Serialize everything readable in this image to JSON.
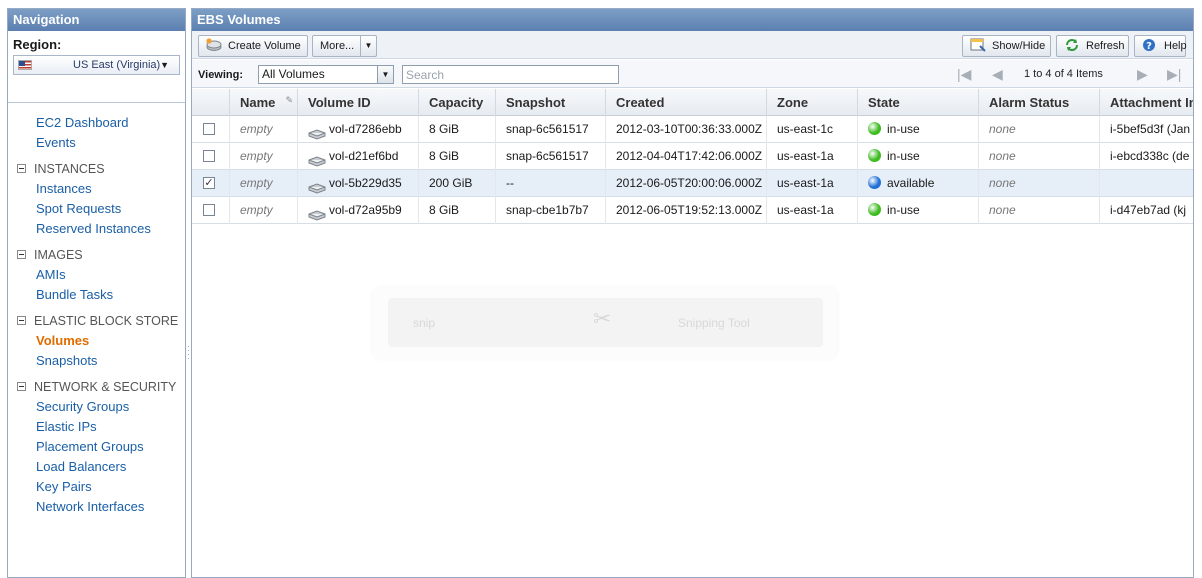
{
  "nav": {
    "title": "Navigation",
    "region_label": "Region:",
    "region_value": "US East (Virginia)",
    "items_top": [
      {
        "label": "EC2 Dashboard"
      },
      {
        "label": "Events"
      }
    ],
    "sections": [
      {
        "title": "INSTANCES",
        "items": [
          "Instances",
          "Spot Requests",
          "Reserved Instances"
        ]
      },
      {
        "title": "IMAGES",
        "items": [
          "AMIs",
          "Bundle Tasks"
        ]
      },
      {
        "title": "ELASTIC BLOCK STORE",
        "items": [
          "Volumes",
          "Snapshots"
        ]
      },
      {
        "title": "NETWORK & SECURITY",
        "items": [
          "Security Groups",
          "Elastic IPs",
          "Placement Groups",
          "Load Balancers",
          "Key Pairs",
          "Network Interfaces"
        ]
      }
    ],
    "active_item": "Volumes"
  },
  "main": {
    "title": "EBS Volumes",
    "toolbar": {
      "create_label": "Create Volume",
      "more_label": "More...",
      "showhide_label": "Show/Hide",
      "refresh_label": "Refresh",
      "help_label": "Help"
    },
    "viewing_label": "Viewing:",
    "viewing_value": "All Volumes",
    "search_placeholder": "Search",
    "pager_text": "1 to 4 of 4 Items",
    "columns": [
      "Name",
      "Volume ID",
      "Capacity",
      "Snapshot",
      "Created",
      "Zone",
      "State",
      "Alarm Status",
      "Attachment In"
    ],
    "rows": [
      {
        "checked": false,
        "name": "empty",
        "volume_id": "vol-d7286ebb",
        "capacity": "8 GiB",
        "snapshot": "snap-6c561517",
        "created": "2012-03-10T00:36:33.000Z",
        "zone": "us-east-1c",
        "state": "in-use",
        "state_color": "#3dbb1f",
        "alarm": "none",
        "attachment": "i-5bef5d3f (Jan"
      },
      {
        "checked": false,
        "name": "empty",
        "volume_id": "vol-d21ef6bd",
        "capacity": "8 GiB",
        "snapshot": "snap-6c561517",
        "created": "2012-04-04T17:42:06.000Z",
        "zone": "us-east-1a",
        "state": "in-use",
        "state_color": "#3dbb1f",
        "alarm": "none",
        "attachment": "i-ebcd338c (de"
      },
      {
        "checked": true,
        "name": "empty",
        "volume_id": "vol-5b229d35",
        "capacity": "200 GiB",
        "snapshot": "--",
        "created": "2012-06-05T20:00:06.000Z",
        "zone": "us-east-1a",
        "state": "available",
        "state_color": "#1f6fd6",
        "alarm": "none",
        "attachment": ""
      },
      {
        "checked": false,
        "name": "empty",
        "volume_id": "vol-d72a95b9",
        "capacity": "8 GiB",
        "snapshot": "snap-cbe1b7b7",
        "created": "2012-06-05T19:52:13.000Z",
        "zone": "us-east-1a",
        "state": "in-use",
        "state_color": "#3dbb1f",
        "alarm": "none",
        "attachment": "i-d47eb7ad (kj"
      }
    ],
    "ghost": {
      "left_text": "snip",
      "right_text": "Snipping Tool"
    }
  }
}
